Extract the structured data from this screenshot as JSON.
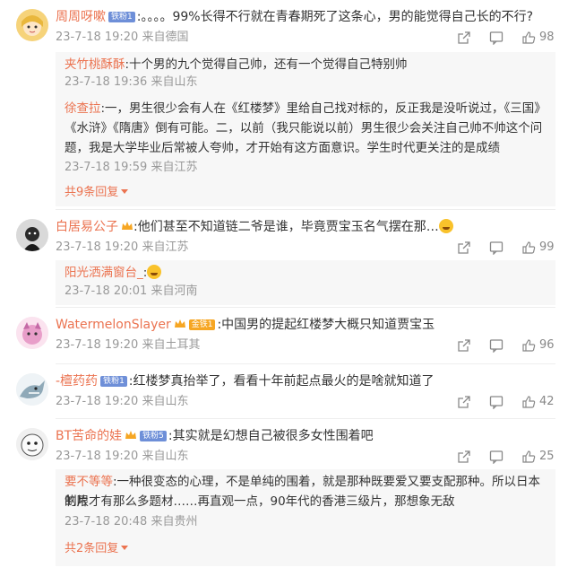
{
  "colors": {
    "username": "#eb7350",
    "meta": "#999999",
    "fan_badge": "#6e8fd8",
    "gold_badge": "#f6a623",
    "reply_bg": "#f7f7f7"
  },
  "comments": [
    {
      "user": "周周呀嗽",
      "badge": "铁粉1",
      "badge_style": "blue",
      "text": ":。。。。99%长得不行就在青春期死了这条心，男的能觉得自己长的不行?",
      "time": "23-7-18 19:20",
      "location": "来自德国",
      "likes": "98",
      "replies": [
        {
          "user": "夹竹桃酥酥",
          "text": ":十个男的九个觉得自己帅，还有一个觉得自己特别帅",
          "time": "23-7-18 19:36",
          "location": "来自山东"
        },
        {
          "user": "徐查拉",
          "text_lines": [
            ":一，男生很少会有人在《红楼梦》里给自己找对标的，反正我是没听说过，《三国》",
            "《水浒》《隋唐》倒有可能。二，以前（我只能说以前）男生很少会关注自己帅不帅这个问",
            "题，我是大学毕业后常被人夸帅，才开始有这方面意识。学生时代更关注的是成绩"
          ],
          "time": "23-7-18 19:59",
          "location": "来自江苏"
        }
      ],
      "more_replies": "共9条回复"
    },
    {
      "user": "白居易公子",
      "text": ":他们甚至不知道链二爷是谁，毕竟贾宝玉名气摆在那…",
      "time": "23-7-18 19:20",
      "location": "来自江苏",
      "likes": "99",
      "replies": [
        {
          "user": "阳光洒满窗台_",
          "text": ":",
          "time": "23-7-18 20:01",
          "location": "来自河南"
        }
      ]
    },
    {
      "user": "WatermelonSlayer",
      "badge": "金铁1",
      "badge_style": "orange",
      "text": ":中国男的提起红楼梦大概只知道贾宝玉",
      "time": "23-7-18 19:20",
      "location": "来自土耳其",
      "likes": "96"
    },
    {
      "user": "-檀药药",
      "badge": "铁粉1",
      "badge_style": "blue",
      "text": ":红楼梦真抬举了，看看十年前起点最火的是啥就知道了",
      "time": "23-7-18 19:20",
      "location": "来自山东",
      "likes": "42"
    },
    {
      "user": "BT苦命的娃",
      "badge": "铁粉5",
      "badge_style": "blue",
      "text": ":其实就是幻想自己被很多女性围着吧",
      "time": "23-7-18 19:20",
      "location": "来自山东",
      "likes": "25",
      "replies": [
        {
          "user": "要不等等",
          "text_lines": [
            ":一种很变态的心理，不是单纯的围着，就是那种既要爱又要支配那种。所以日本的限",
            "制片才有那么多题材……再直观一点，90年代的香港三级片，那想象无敌"
          ],
          "time": "23-7-18 20:48",
          "location": "来自贵州"
        }
      ],
      "more_replies": "共2条回复"
    }
  ],
  "icons": {
    "share": "share-icon",
    "comment": "comment-icon",
    "like": "thumbs-up-icon"
  }
}
